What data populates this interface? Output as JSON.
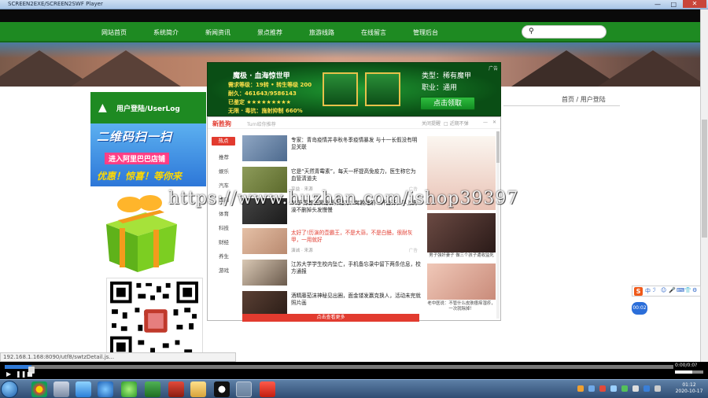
{
  "window": {
    "title": "SCREEN2EXE/SCREEN2SWF Player",
    "minimize": "—",
    "maximize": "□",
    "close": "✕"
  },
  "nav": {
    "items": [
      "网站首页",
      "新闻资讯",
      "景点推荐",
      "旅游线路",
      "在线留言",
      "管理后台"
    ],
    "hidden_item": "系统简介",
    "search_icon": "search-icon"
  },
  "breadcrumb": {
    "home": "首页",
    "sep": " / ",
    "current": "用户登陆"
  },
  "login": {
    "title": "用户登陆/UserLog",
    "promo_line1": "二维码扫一扫",
    "promo_line2": "进入阿里巴巴店铺",
    "promo_line3": "优惠！惊喜！等你来"
  },
  "status_url": "192.168.1.168:8090/utf8/swtzDetail.js...",
  "game_ad": {
    "corner": "广告",
    "title": "魔极 · 血海惊世甲",
    "line1": "需求等级：19转 • 转生等级 200",
    "line2": "耐久：461643/9586143",
    "line3": "已鉴定 ★★★★★★★★★",
    "line4": "无限 · 毒抗：施射抑制 660%",
    "type": "类型：稀有魔甲",
    "job": "职业：通用",
    "cta": "点击领取"
  },
  "news_popup": {
    "logo": "新胜狗",
    "subtitle": "Turn给你推荐",
    "ctl_close_text": "关闭提醒",
    "ctl_checkbox": "□ 近期不弹",
    "categories": [
      "热点",
      "推荐",
      "娱乐",
      "汽车",
      "国内",
      "体育",
      "科技",
      "财经",
      "养生",
      "游戏"
    ],
    "rows": [
      {
        "headline": "专家：青岛疫情并非秋冬季疫情暴发 与十一长假没有明显关联",
        "meta": "",
        "ad": "",
        "red": false
      },
      {
        "headline": "它是“天然青霉素”，每天一杯提高免疫力，医生称它为血管清道夫",
        "meta": "享益 · 来源",
        "ad": "广告",
        "red": false
      },
      {
        "headline": "69岁男首长揭秘保养秘方：每晚睡前一杯白开，早上洗澡不删掉头发慢慢",
        "meta": "",
        "ad": "",
        "red": false
      },
      {
        "headline": "太好了!历演的壶霸王，不是大蒜，不是白醋，很耐灰甲，一用就好",
        "meta": "演诚 · 来源",
        "ad": "广告",
        "red": true
      },
      {
        "headline": "江苏大学学生校内坠亡，手机备忘录中留下两条信息，校方通报",
        "meta": "",
        "ad": "",
        "red": false
      },
      {
        "headline": "酒精藤茄沫神秘见出圈，面金镂发赢克换人，活动未完就照片画",
        "meta": "",
        "ad": "",
        "red": false
      }
    ],
    "side_captions": [
      "男子强奸妻子 做三个孩子遭收监死",
      "老中医说：不管什么皮肤瘙痒湿疹，一次就除掉！"
    ],
    "bottom": "点击查看更多"
  },
  "watermark": "https://www.huzhan.com/ishop39397",
  "ime": {
    "logo": "S",
    "labels": [
      "中",
      "ℐ",
      "☺",
      "🎤",
      "⌨",
      "👕",
      "⚙"
    ],
    "bubble": "00:02"
  },
  "player": {
    "time": "0:00/0:0?",
    "progress_fraction": 0.04,
    "volume_fraction": 0.6
  },
  "taskbar": {
    "apps": [
      "chrome-icon",
      "media-icon",
      "baidu-icon",
      "ie-icon",
      "green-app-icon",
      "excel-icon",
      "flash-icon",
      "folder-icon",
      "qq-icon",
      "player-icon",
      "ff-icon"
    ],
    "time": "01:12",
    "date": "2020-10-17"
  },
  "colors": {
    "nav_green": "#1e8a22",
    "accent_red": "#e23b2f",
    "ime_orange": "#f05a1a"
  }
}
